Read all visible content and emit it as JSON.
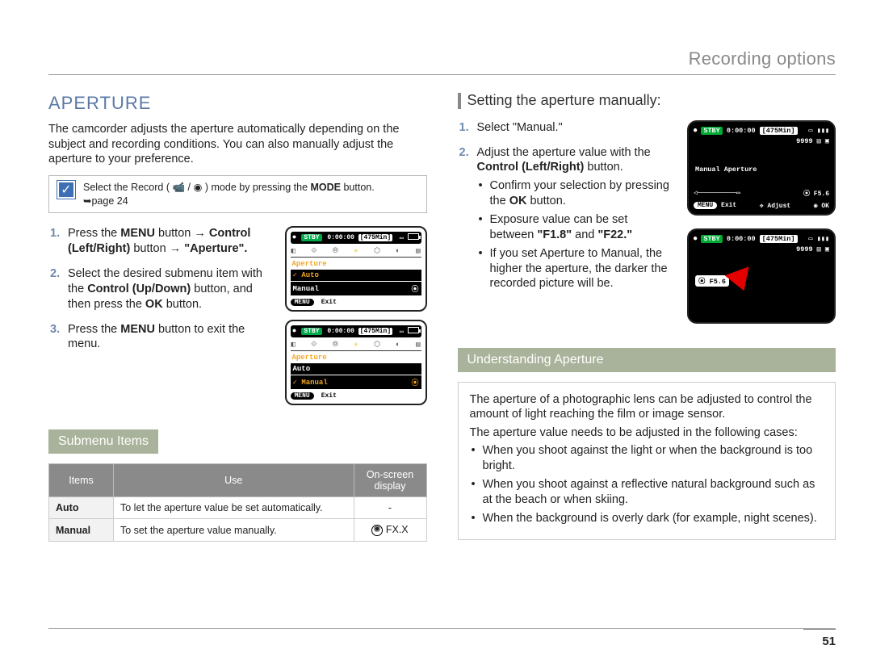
{
  "header": {
    "title": "Recording options"
  },
  "page_number": "51",
  "left": {
    "section_title": "APERTURE",
    "intro": "The camcorder adjusts the aperture automatically depending on the subject and recording conditions. You can also manually adjust the aperture to your preference.",
    "note": {
      "pre": "Select the Record ( ",
      "mid": " ) mode by pressing the ",
      "mode": "MODE",
      "post": " button.",
      "pageref": "➥page 24"
    },
    "steps": {
      "s1_a": "Press the ",
      "s1_menu": "MENU",
      "s1_b": " button → ",
      "s1_ctrl": "Control (Left/Right)",
      "s1_c": "button → ",
      "s1_ap": "\"Aperture\".",
      "s2_a": "Select the desired submenu item with the ",
      "s2_ctrl": "Control (Up/Down)",
      "s2_b": " button, and then press the ",
      "s2_ok": "OK",
      "s2_c": " button.",
      "s3_a": "Press the ",
      "s3_menu": "MENU",
      "s3_b": " button to exit the menu."
    },
    "screen": {
      "stby": "STBY",
      "time": "0:00:00",
      "remain": "[475Min]",
      "menu_label": "Aperture",
      "opt_auto": "Auto",
      "opt_manual": "Manual",
      "menu_btn": "MENU",
      "exit": "Exit"
    },
    "submenu_heading": "Submenu Items",
    "table": {
      "h_items": "Items",
      "h_use": "Use",
      "h_osd": "On-screen display",
      "r1_item": "Auto",
      "r1_use": "To let the aperture value be set automatically.",
      "r1_osd": "-",
      "r2_item": "Manual",
      "r2_use": "To set the aperture value manually.",
      "r2_osd": "FX.X"
    }
  },
  "right": {
    "subheading": "Setting the aperture manually:",
    "steps": {
      "s1": "Select \"Manual.\"",
      "s2_a": "Adjust the aperture value with the ",
      "s2_ctrl": "Control (Left/Right)",
      "s2_b": " button.",
      "b1_a": "Confirm your selection by pressing the ",
      "b1_ok": "OK",
      "b1_b": " button.",
      "b2_a": "Exposure value can be set between ",
      "b2_v1": "\"F1.8\"",
      "b2_mid": " and ",
      "b2_v2": "\"F22.\"",
      "b3": "If you set Aperture to Manual, the higher the aperture, the darker the recorded picture will be."
    },
    "screen": {
      "stby": "STBY",
      "time": "0:00:00",
      "remain": "[475Min]",
      "count": "9999",
      "mlabel": "Manual Aperture",
      "fval": "F5.6",
      "menu_btn": "MENU",
      "exit": "Exit",
      "adjust": "Adjust",
      "ok": "OK"
    },
    "understand_heading": "Understanding Aperture",
    "u_p1": "The aperture of a photographic lens can be adjusted to control the amount of light reaching the film or image sensor.",
    "u_p2": "The aperture value needs to be adjusted in the following cases:",
    "u_b1": "When you shoot against the light or when the background is too bright.",
    "u_b2": "When you shoot against a reflective natural background such as at the beach or when skiing.",
    "u_b3": "When the background is overly dark (for example, night scenes)."
  }
}
